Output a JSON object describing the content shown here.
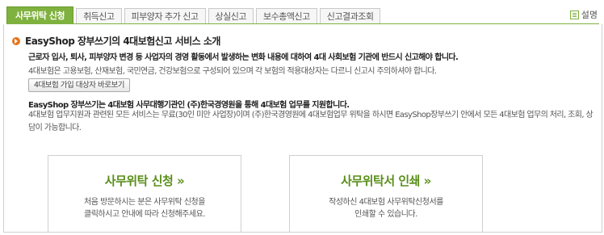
{
  "tabs": [
    {
      "label": "사무위탁 신청",
      "active": true
    },
    {
      "label": "취득신고",
      "active": false
    },
    {
      "label": "피부양자 추가 신고",
      "active": false
    },
    {
      "label": "상실신고",
      "active": false
    },
    {
      "label": "보수총액신고",
      "active": false
    },
    {
      "label": "신고결과조회",
      "active": false
    }
  ],
  "help": {
    "label": "설명",
    "icon": "list-icon"
  },
  "intro": {
    "title": "EasyShop 장부쓰기의 4대보험신고 서비스 소개",
    "line1": "근로자 입사, 퇴사, 피부양자 변경 등 사업자의 경영 활동에서 발생하는 변화 내용에 대하여 4대 사회보험 기관에 반드시 신고해야 합니다.",
    "line2": "4대보험은 고용보험, 산재보험, 국민연금, 건강보험으로 구성되어 있으며 각 보험의 적용대상자는 다르니 신고시 주의하셔야 합니다.",
    "button": "4대보험 가입 대상자 바로보기",
    "line3": "EasyShop 장부쓰기는 4대보험 사무대행기관인 (주)한국경영원을 통해 4대보험 업무를 지원합니다.",
    "line4": "4대보험 업무지원과 관련된 모든 서비스는 무료(30인 미만 사업장)이며 (주)한국경영원에 4대보험업무 위탁을 하시면 EasyShop장부쓰기 안에서 모든 4대보험 업무의 처리, 조회, 상담이 가능합니다."
  },
  "cards": {
    "apply": {
      "title": "사무위탁 신청 »",
      "desc1": "처음 방문하시는 분은 사무위탁 신청을",
      "desc2": "클릭하시고 안내에 따라 신청해주세요."
    },
    "print": {
      "title": "사무위탁서 인쇄 »",
      "desc1": "작성하신 4대보험 사무위탁신청서를",
      "desc2": "인쇄할 수 있습니다."
    }
  },
  "colors": {
    "accent": "#7fb13e",
    "bullet": "#e8741b",
    "card_title": "#5a8e1a"
  }
}
